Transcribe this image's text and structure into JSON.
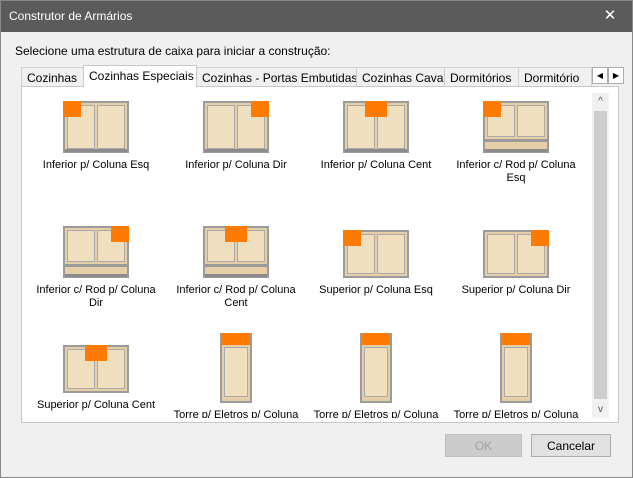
{
  "window": {
    "title": "Construtor de Armários",
    "close_glyph": "✕"
  },
  "prompt": "Selecione uma estrutura de caixa para iniciar a construção:",
  "tabs": [
    {
      "label": "Cozinhas"
    },
    {
      "label": "Cozinhas Especiais"
    },
    {
      "label": "Cozinhas - Portas Embutidas"
    },
    {
      "label": "Cozinhas Cava"
    },
    {
      "label": "Dormitórios"
    },
    {
      "label": "Dormitório"
    }
  ],
  "tab_scroll": {
    "left": "◀",
    "right": "▶"
  },
  "items": [
    {
      "label": "Inferior p/ Coluna Esq",
      "icon": "cabinet-lower-left-column-icon"
    },
    {
      "label": "Inferior p/ Coluna Dir",
      "icon": "cabinet-lower-right-column-icon"
    },
    {
      "label": "Inferior p/ Coluna Cent",
      "icon": "cabinet-lower-center-column-icon"
    },
    {
      "label": "Inferior c/ Rod  p/ Coluna Esq",
      "icon": "cabinet-lower-plinth-left-icon"
    },
    {
      "label": "Inferior c/ Rod p/ Coluna Dir",
      "icon": "cabinet-lower-plinth-right-icon"
    },
    {
      "label": "Inferior c/ Rod p/ Coluna Cent",
      "icon": "cabinet-lower-plinth-center-icon"
    },
    {
      "label": "Superior p/ Coluna Esq",
      "icon": "cabinet-upper-left-column-icon"
    },
    {
      "label": "Superior p/ Coluna Dir",
      "icon": "cabinet-upper-right-column-icon"
    },
    {
      "label": "Superior p/ Coluna Cent",
      "icon": "cabinet-upper-center-column-icon"
    },
    {
      "label": "Torre p/ Eletros p/ Coluna Esq",
      "icon": "tower-appliance-left-icon"
    },
    {
      "label": "Torre p/ Eletros p/ Coluna Dir",
      "icon": "tower-appliance-right-icon"
    },
    {
      "label": "Torre p/ Eletros p/ Coluna Cent",
      "icon": "tower-appliance-center-icon"
    }
  ],
  "scrollbar": {
    "up": "^",
    "down": "v"
  },
  "buttons": {
    "ok": "OK",
    "cancel": "Cancelar"
  },
  "colors": {
    "titlebar": "#5b5b5b",
    "highlight": "#ff7a00",
    "wood": "#e6cfa7"
  }
}
